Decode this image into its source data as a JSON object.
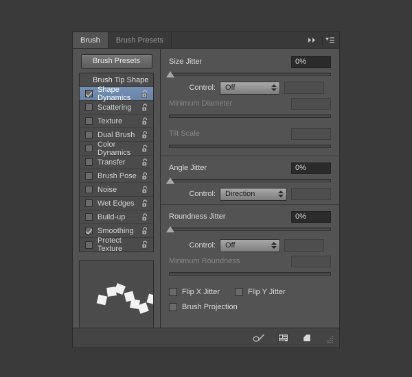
{
  "panel": {
    "tabs": [
      {
        "label": "Brush",
        "active": true
      },
      {
        "label": "Brush Presets",
        "active": false
      }
    ],
    "collapse_icon": "double-chevron-right-icon",
    "menu_icon": "panel-menu-icon",
    "presets_button": "Brush Presets"
  },
  "options": {
    "header": "Brush Tip Shape",
    "items": [
      {
        "label": "Shape Dynamics",
        "checked": true,
        "selected": true
      },
      {
        "label": "Scattering",
        "checked": false,
        "selected": false
      },
      {
        "label": "Texture",
        "checked": false,
        "selected": false
      },
      {
        "label": "Dual Brush",
        "checked": false,
        "selected": false
      },
      {
        "label": "Color Dynamics",
        "checked": false,
        "selected": false
      },
      {
        "label": "Transfer",
        "checked": false,
        "selected": false
      },
      {
        "label": "Brush Pose",
        "checked": false,
        "selected": false
      },
      {
        "label": "Noise",
        "checked": false,
        "selected": false
      },
      {
        "label": "Wet Edges",
        "checked": false,
        "selected": false
      },
      {
        "label": "Build-up",
        "checked": false,
        "selected": false
      },
      {
        "label": "Smoothing",
        "checked": true,
        "selected": false
      },
      {
        "label": "Protect Texture",
        "checked": false,
        "selected": false
      }
    ],
    "lock_icon": "unlocked-padlock-icon"
  },
  "preview": {
    "name": "brush-stroke-preview"
  },
  "controls": {
    "size_jitter": {
      "label": "Size Jitter",
      "value": "0%",
      "slider_percent": 0
    },
    "size_jitter_control": {
      "label": "Control:",
      "value": "Off"
    },
    "minimum_diameter": {
      "label": "Minimum Diameter",
      "value": "",
      "slider_percent": 0,
      "disabled": true
    },
    "tilt_scale": {
      "label": "Tilt Scale",
      "value": "",
      "slider_percent": 0,
      "disabled": true
    },
    "angle_jitter": {
      "label": "Angle Jitter",
      "value": "0%",
      "slider_percent": 0
    },
    "angle_jitter_control": {
      "label": "Control:",
      "value": "Direction"
    },
    "roundness_jitter": {
      "label": "Roundness Jitter",
      "value": "0%",
      "slider_percent": 0
    },
    "roundness_jitter_control": {
      "label": "Control:",
      "value": "Off"
    },
    "minimum_roundness": {
      "label": "Minimum Roundness",
      "value": "",
      "slider_percent": 0,
      "disabled": true
    },
    "flip_x": {
      "label": "Flip X Jitter",
      "checked": false
    },
    "flip_y": {
      "label": "Flip Y Jitter",
      "checked": false
    },
    "brush_projection": {
      "label": "Brush Projection",
      "checked": false
    }
  },
  "footer": {
    "icons": [
      "toggle-brush-tip-icon",
      "brush-preset-manager-icon",
      "new-brush-preset-icon"
    ],
    "resize_grip": "resize-grip-icon"
  },
  "colors": {
    "panel_bg": "#535353",
    "app_bg": "#3a3a3a",
    "selection_blue": "#7490b4",
    "text": "#dcdcdc",
    "text_dim": "#868686",
    "field_bg": "#2b2b2b"
  }
}
